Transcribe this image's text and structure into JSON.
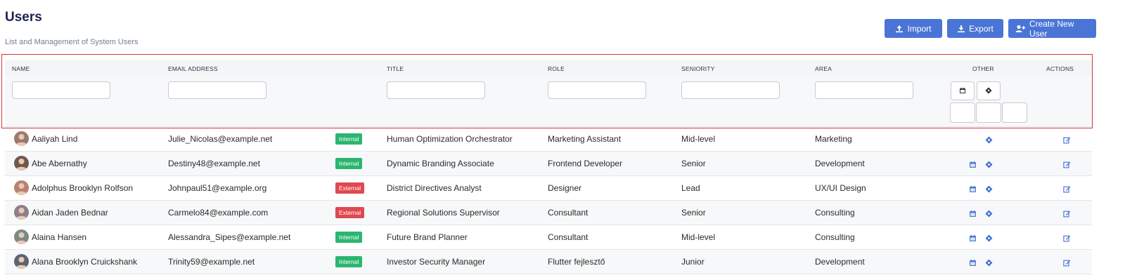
{
  "page": {
    "title": "Users",
    "subtitle": "List and Management of System Users"
  },
  "toolbar": {
    "import_label": "Import",
    "export_label": "Export",
    "create_label": "Create New User"
  },
  "columns": {
    "name": "NAME",
    "email": "EMAIL ADDRESS",
    "title": "TITLE",
    "role": "ROLE",
    "seniority": "SENIORITY",
    "area": "AREA",
    "other": "OTHER",
    "actions": "ACTIONS"
  },
  "colors": {
    "accent": "#4a75d6",
    "internal": "#2bb670",
    "external": "#e0484f",
    "highlight_frame": "#d4333b"
  },
  "rows": [
    {
      "name": "Aaliyah Lind",
      "email": "Julie_Nicolas@example.net",
      "badge": "Internal",
      "title": "Human Optimization Orchestrator",
      "role": "Marketing Assistant",
      "seniority": "Mid-level",
      "area": "Marketing",
      "has_calendar": false
    },
    {
      "name": "Abe Abernathy",
      "email": "Destiny48@example.net",
      "badge": "Internal",
      "title": "Dynamic Branding Associate",
      "role": "Frontend Developer",
      "seniority": "Senior",
      "area": "Development",
      "has_calendar": true
    },
    {
      "name": "Adolphus Brooklyn Rolfson",
      "email": "Johnpaul51@example.org",
      "badge": "External",
      "title": "District Directives Analyst",
      "role": "Designer",
      "seniority": "Lead",
      "area": "UX/UI Design",
      "has_calendar": true
    },
    {
      "name": "Aidan Jaden Bednar",
      "email": "Carmelo84@example.com",
      "badge": "External",
      "title": "Regional Solutions Supervisor",
      "role": "Consultant",
      "seniority": "Senior",
      "area": "Consulting",
      "has_calendar": true
    },
    {
      "name": "Alaina Hansen",
      "email": "Alessandra_Sipes@example.net",
      "badge": "Internal",
      "title": "Future Brand Planner",
      "role": "Consultant",
      "seniority": "Mid-level",
      "area": "Consulting",
      "has_calendar": true
    },
    {
      "name": "Alana Brooklyn Cruickshank",
      "email": "Trinity59@example.net",
      "badge": "Internal",
      "title": "Investor Security Manager",
      "role": "Flutter fejlesztő",
      "seniority": "Junior",
      "area": "Development",
      "has_calendar": true
    }
  ]
}
